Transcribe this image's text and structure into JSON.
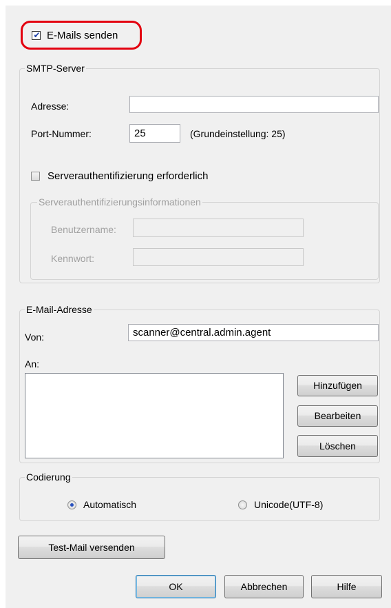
{
  "send_emails": {
    "label": "E-Mails senden",
    "checked": true
  },
  "smtp": {
    "legend": "SMTP-Server",
    "address_label": "Adresse:",
    "address_value": "",
    "port_label": "Port-Nummer:",
    "port_value": "25",
    "port_hint": "(Grundeinstellung: 25)",
    "auth_label": "Serverauthentifizierung erforderlich",
    "auth_checked": false,
    "auth_info": {
      "legend": "Serverauthentifizierungsinformationen",
      "username_label": "Benutzername:",
      "username_value": "",
      "password_label": "Kennwort:",
      "password_value": ""
    }
  },
  "email": {
    "legend": "E-Mail-Adresse",
    "from_label": "Von:",
    "from_value": "scanner@central.admin.agent",
    "to_label": "An:",
    "to_items": [],
    "add_label": "Hinzufügen",
    "edit_label": "Bearbeiten",
    "delete_label": "Löschen"
  },
  "encoding": {
    "legend": "Codierung",
    "options": [
      {
        "label": "Automatisch",
        "selected": true
      },
      {
        "label": "Unicode(UTF-8)",
        "selected": false
      }
    ]
  },
  "test_mail_label": "Test-Mail versenden",
  "footer": {
    "ok_label": "OK",
    "cancel_label": "Abbrechen",
    "help_label": "Hilfe"
  },
  "colors": {
    "highlight": "#e3000f",
    "dialog_bg": "#f0f0f0"
  }
}
